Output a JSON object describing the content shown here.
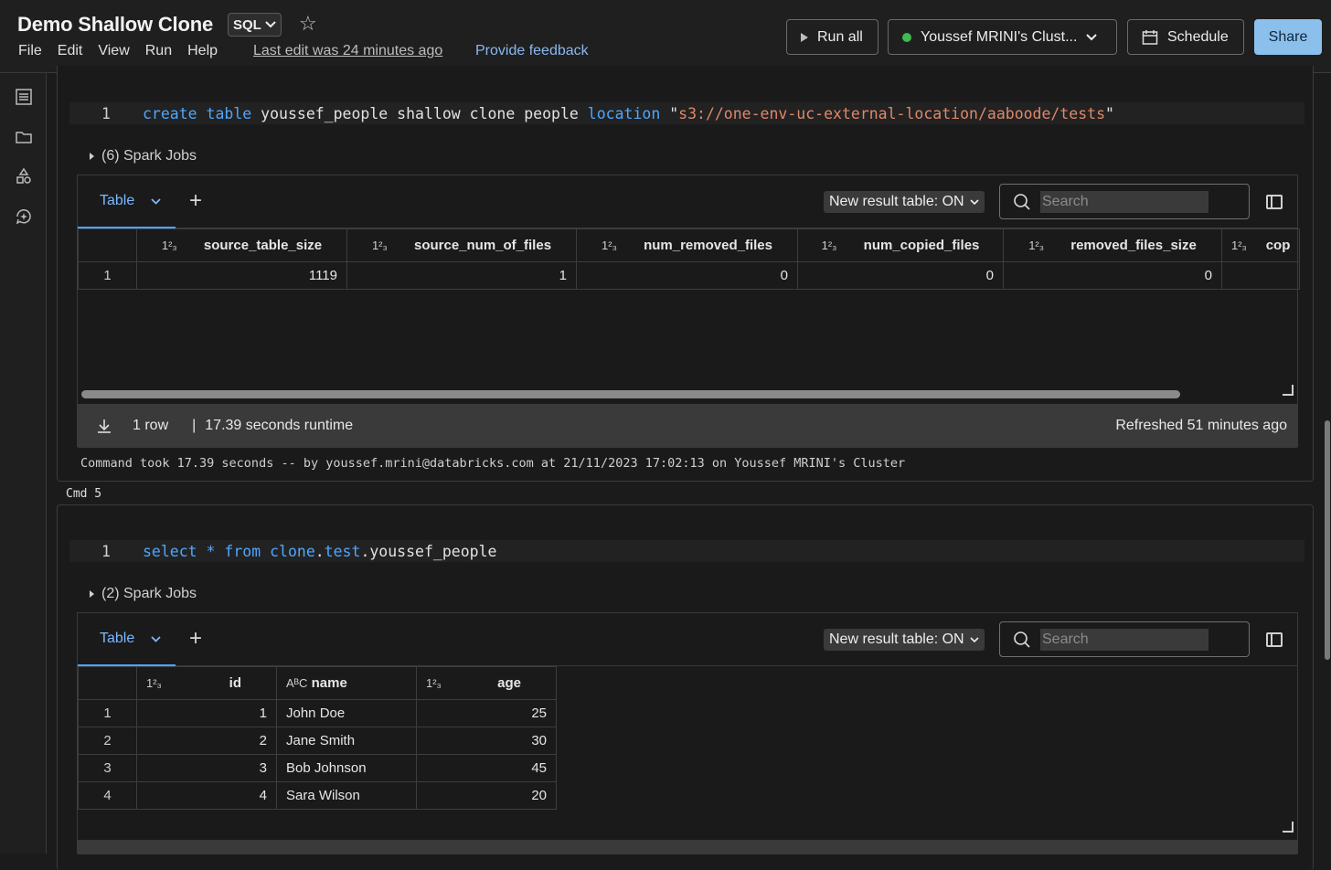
{
  "header": {
    "title": "Demo Shallow Clone",
    "language": "SQL",
    "menu": [
      "File",
      "Edit",
      "View",
      "Run",
      "Help"
    ],
    "last_edit": "Last edit was 24 minutes ago",
    "feedback": "Provide feedback",
    "run_all": "Run all",
    "cluster": "Youssef MRINI's Clust...",
    "schedule": "Schedule",
    "share": "Share"
  },
  "cell1": {
    "line_no": "1",
    "code": {
      "kw1": "create table",
      "t1": " youssef_people shallow clone people ",
      "kw2": "location",
      "t2": " \"",
      "str": "s3://one-env-uc-external-location/aaboode/tests",
      "t3": "\""
    },
    "spark_jobs": "(6) Spark Jobs",
    "tab_label": "Table",
    "new_result": "New result table: ON",
    "search_placeholder": "Search",
    "type_icon": "1²₃",
    "columns": [
      "source_table_size",
      "source_num_of_files",
      "num_removed_files",
      "num_copied_files",
      "removed_files_size",
      "cop"
    ],
    "rows": [
      [
        "1",
        "1119",
        "1",
        "0",
        "0",
        "0"
      ]
    ],
    "row_count": "1 row",
    "runtime": "17.39 seconds runtime",
    "refreshed": "Refreshed 51 minutes ago",
    "command_info": "Command took 17.39 seconds -- by youssef.mrini@databricks.com at 21/11/2023 17:02:13 on Youssef MRINI's Cluster"
  },
  "cmd_label": "Cmd 5",
  "cell2": {
    "line_no": "1",
    "code": {
      "kw1": "select * from",
      "t1": " ",
      "ns1": "clone",
      "dot1": ".",
      "ns2": "test",
      "t2": ".youssef_people"
    },
    "spark_jobs": "(2) Spark Jobs",
    "tab_label": "Table",
    "new_result": "New result table: ON",
    "search_placeholder": "Search",
    "columns": [
      {
        "type": "1²₃",
        "name": "id"
      },
      {
        "type": "AᴮC",
        "name": "name"
      },
      {
        "type": "1²₃",
        "name": "age"
      }
    ],
    "rows": [
      [
        "1",
        "1",
        "John Doe",
        "25"
      ],
      [
        "2",
        "2",
        "Jane Smith",
        "30"
      ],
      [
        "3",
        "3",
        "Bob Johnson",
        "45"
      ],
      [
        "4",
        "4",
        "Sara Wilson",
        "20"
      ]
    ]
  },
  "colors": {
    "accent": "#4fa6ff",
    "share": "#8cc0ec",
    "status": "#3fb950",
    "string": "#e0876a"
  }
}
